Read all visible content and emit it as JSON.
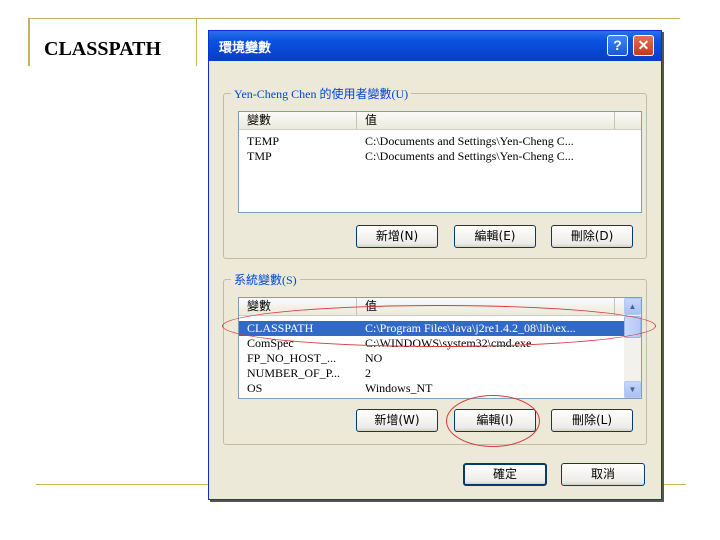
{
  "slide": {
    "title": "CLASSPATH"
  },
  "window": {
    "title": "環境變數",
    "help_label": "?",
    "close_label": "✕"
  },
  "user_vars": {
    "legend": "Yen-Cheng Chen 的使用者變數(U)",
    "headers": [
      "變數",
      "值"
    ],
    "rows": [
      {
        "name": "TEMP",
        "value": "C:\\Documents and Settings\\Yen-Cheng C..."
      },
      {
        "name": "TMP",
        "value": "C:\\Documents and Settings\\Yen-Cheng C..."
      }
    ],
    "buttons": {
      "new": "新增(N)",
      "edit": "編輯(E)",
      "delete": "刪除(D)"
    }
  },
  "system_vars": {
    "legend": "系統變數(S)",
    "headers": [
      "變數",
      "值"
    ],
    "rows": [
      {
        "name": "CLASSPATH",
        "value": "C:\\Program Files\\Java\\j2re1.4.2_08\\lib\\ex...",
        "selected": true
      },
      {
        "name": "ComSpec",
        "value": "C:\\WINDOWS\\system32\\cmd.exe"
      },
      {
        "name": "FP_NO_HOST_...",
        "value": "NO"
      },
      {
        "name": "NUMBER_OF_P...",
        "value": "2"
      },
      {
        "name": "OS",
        "value": "Windows_NT"
      }
    ],
    "buttons": {
      "new": "新增(W)",
      "edit": "編輯(I)",
      "delete": "刪除(L)"
    }
  },
  "dialog_buttons": {
    "ok": "確定",
    "cancel": "取消"
  },
  "colors": {
    "titlebar": "#0a54e0",
    "annotation": "#d83a3a",
    "selection": "#316ac5"
  }
}
